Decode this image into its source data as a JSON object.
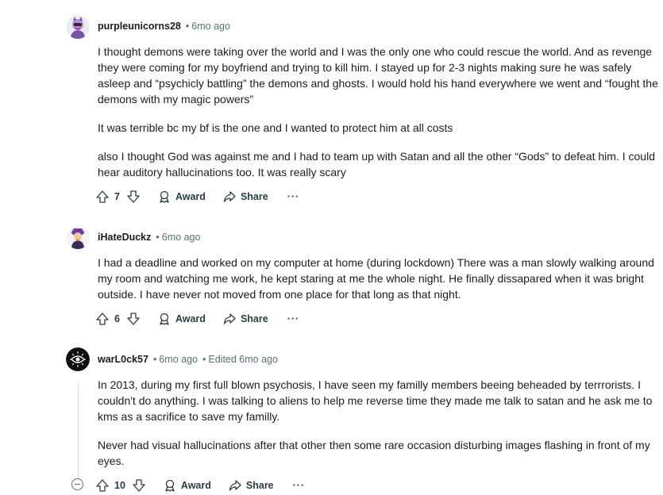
{
  "comments": [
    {
      "username": "purpleunicorns28",
      "time": "6mo ago",
      "edited": "",
      "paragraphs": [
        "I thought demons were taking over the world and I was the only one who could rescue the world. And as revenge they were coming for my boyfriend and trying to kill him. I stayed up for 2-3 nights making sure he was safely asleep and “psychicly battling” the demons and ghosts. I would hold his hand everywhere we went and “fought the demons with my magic powers”",
        "It was terrible bc my bf is the one and I wanted to protect him at all costs",
        "also I thought God was against me and I had to team up with Satan and all the other “Gods” to defeat him. I could hear auditory hallucinations too. It was really scary"
      ],
      "votes": "7"
    },
    {
      "username": "iHateDuckz",
      "time": "6mo ago",
      "edited": "",
      "paragraphs": [
        "I had a deadline and worked on my computer at home (during lockdown) There was a man slowly walking around my room and watching me work, he kept staring at me the whole night. He finally dissapared when it was bright outside. I have never not moved from one place for that long as that night."
      ],
      "votes": "6"
    },
    {
      "username": "warL0ck57",
      "time": "6mo ago",
      "edited": "Edited 6mo ago",
      "paragraphs": [
        "In 2013, during my first full blown psychosis, I have seen my familly members beeing beheaded by terrrorists. I couldn't do anything. I was talking to aliens to help me reverse time they made me talk to satan and he ask me to kms as a sacrifice to save my familly.",
        "Never had visual hallucinations after that other then some rare occasion disturbing images flashing in front of my eyes."
      ],
      "votes": "10"
    }
  ],
  "labels": {
    "award": "Award",
    "share": "Share",
    "more": "···",
    "dot": "•"
  },
  "icons": [
    "upvote-icon",
    "downvote-icon",
    "award-icon",
    "share-icon",
    "collapse-icon"
  ],
  "colors": {
    "text": "#1c1c1c",
    "meta": "#576f76",
    "action": "#2a3c42",
    "thread": "#d6dde0"
  }
}
